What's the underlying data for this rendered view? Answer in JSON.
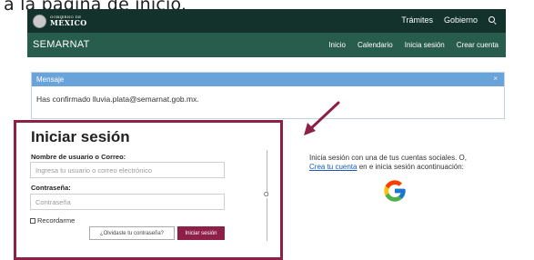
{
  "caption": "a la página de inicio.",
  "header": {
    "logo_small": "GOBIERNO DE",
    "logo_big": "MÉXICO",
    "nav": [
      "Trámites",
      "Gobierno"
    ]
  },
  "subheader": {
    "brand": "SEMARNAT",
    "nav": [
      "Inicio",
      "Calendario",
      "Inicia sesión",
      "Crear cuenta"
    ]
  },
  "alert": {
    "title": "Mensaje",
    "close": "×",
    "body": "Has confirmado lluvia.plata@semarnat.gob.mx."
  },
  "login": {
    "title": "Iniciar sesión",
    "username_label": "Nombre de usuario o Correo:",
    "username_placeholder": "Ingresa tu usuario o correo electrónico",
    "password_label": "Contraseña:",
    "password_placeholder": "Contraseña",
    "remember_label": "Recordarme",
    "forgot_label": "¿Olvidaste tu contraseña?",
    "submit_label": "Iniciar sesión",
    "divider_text": "O"
  },
  "social": {
    "text_before": "Inicia sesión con una de tus cuentas sociales. O,",
    "link_text": "Crea tu cuenta",
    "text_after": " en e inicia sesión acontinuación:"
  },
  "colors": {
    "topbar": "#13322b",
    "subbar": "#285c4d",
    "accent": "#8e2047",
    "alert_header": "#6aa3da",
    "link": "#1a58b5"
  },
  "icons": [
    "search-icon",
    "google-icon",
    "annotation-arrow-icon"
  ]
}
